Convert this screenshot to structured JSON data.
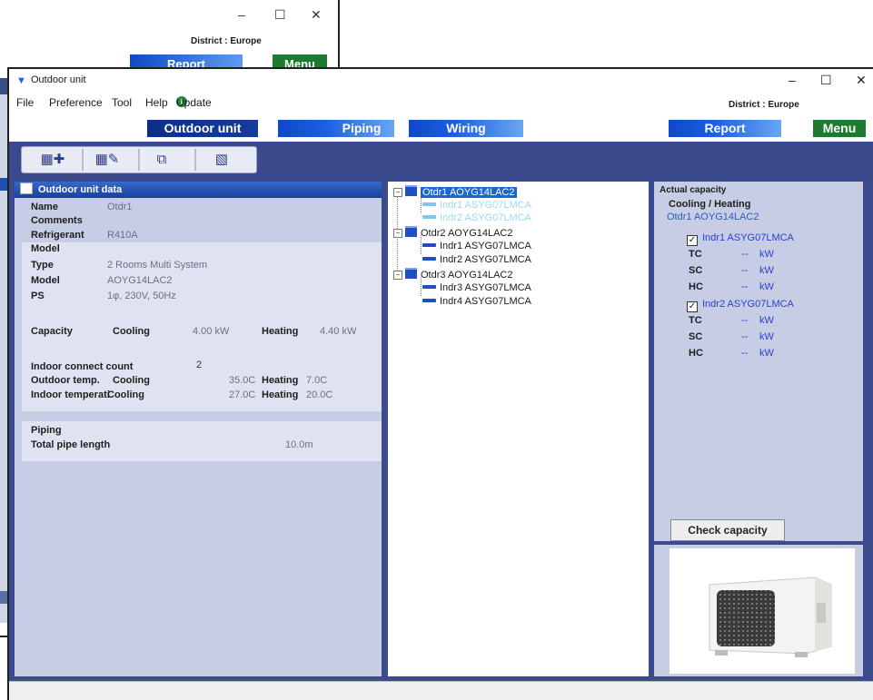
{
  "bg_window": {
    "minimize": "–",
    "maximize": "☐",
    "close": "✕",
    "district": "District : Europe",
    "report_label": "Report",
    "menu_label": "Menu"
  },
  "window": {
    "title": "Outdoor unit",
    "minimize": "–",
    "maximize": "☐",
    "close": "✕"
  },
  "menubar": {
    "file": "File",
    "preference": "Preference",
    "tool": "Tool",
    "help": "Help",
    "update": "Update",
    "district": "District : Europe"
  },
  "nav": {
    "outdoor_unit": "Outdoor unit",
    "piping": "Piping",
    "wiring": "Wiring",
    "report": "Report",
    "menu": "Menu"
  },
  "toolbar": {
    "icons": [
      "add-unit-icon",
      "edit-unit-icon",
      "copy-unit-icon",
      "delete-unit-icon"
    ]
  },
  "outdoor_unit_data": {
    "header": "Outdoor unit data",
    "name_label": "Name",
    "name_value": "Otdr1",
    "comments_label": "Comments",
    "refrigerant_label": "Refrigerant",
    "refrigerant_value": "R410A",
    "model_section": "Model",
    "type_label": "Type",
    "type_value": "2 Rooms Multi System",
    "model_label": "Model",
    "model_value": "AOYG14LAC2",
    "ps_label": "PS",
    "ps_value": "1φ, 230V, 50Hz",
    "capacity_label": "Capacity",
    "cooling_label": "Cooling",
    "cooling_capacity": "4.00 kW",
    "heating_label": "Heating",
    "heating_capacity": "4.40 kW",
    "indoor_count_label": "Indoor connect count",
    "indoor_count_value": "2",
    "outdoor_temp_label": "Outdoor temp.",
    "outdoor_cooling_label": "Cooling",
    "outdoor_cooling_value": "35.0C",
    "outdoor_heating_label": "Heating",
    "outdoor_heating_value": "7.0C",
    "indoor_temp_label": "Indoor temperati",
    "indoor_cooling_label": "Cooling",
    "indoor_cooling_value": "27.0C",
    "indoor_heating_label": "Heating",
    "indoor_heating_value": "20.0C",
    "piping_section": "Piping",
    "pipe_length_label": "Total pipe length",
    "pipe_length_value": "10.0m"
  },
  "tree": [
    {
      "label": "Otdr1  AOYG14LAC2",
      "type": "outdoor",
      "selected": true,
      "children": [
        "Indr1  ASYG07LMCA",
        "Indr2  ASYG07LMCA"
      ]
    },
    {
      "label": "Otdr2  AOYG14LAC2",
      "type": "outdoor",
      "selected": false,
      "children": [
        "Indr1  ASYG07LMCA",
        "Indr2  ASYG07LMCA"
      ]
    },
    {
      "label": "Otdr3  AOYG14LAC2",
      "type": "outdoor",
      "selected": false,
      "children": [
        "Indr3  ASYG07LMCA",
        "Indr4  ASYG07LMCA"
      ]
    }
  ],
  "capacity_panel": {
    "title": "Actual capacity",
    "subtitle": "Cooling / Heating",
    "unit": "Otdr1  AOYG14LAC2",
    "indoor": [
      {
        "label": "Indr1  ASYG07LMCA",
        "checked": true,
        "tc": "--",
        "sc": "--",
        "hc": "--"
      },
      {
        "label": "Indr2  ASYG07LMCA",
        "checked": true,
        "tc": "--",
        "sc": "--",
        "hc": "--"
      }
    ],
    "tc_label": "TC",
    "sc_label": "SC",
    "hc_label": "HC",
    "unit_kw": "kW",
    "check_button": "Check capacity"
  },
  "image": {
    "depicts": "outdoor-unit-photo"
  }
}
